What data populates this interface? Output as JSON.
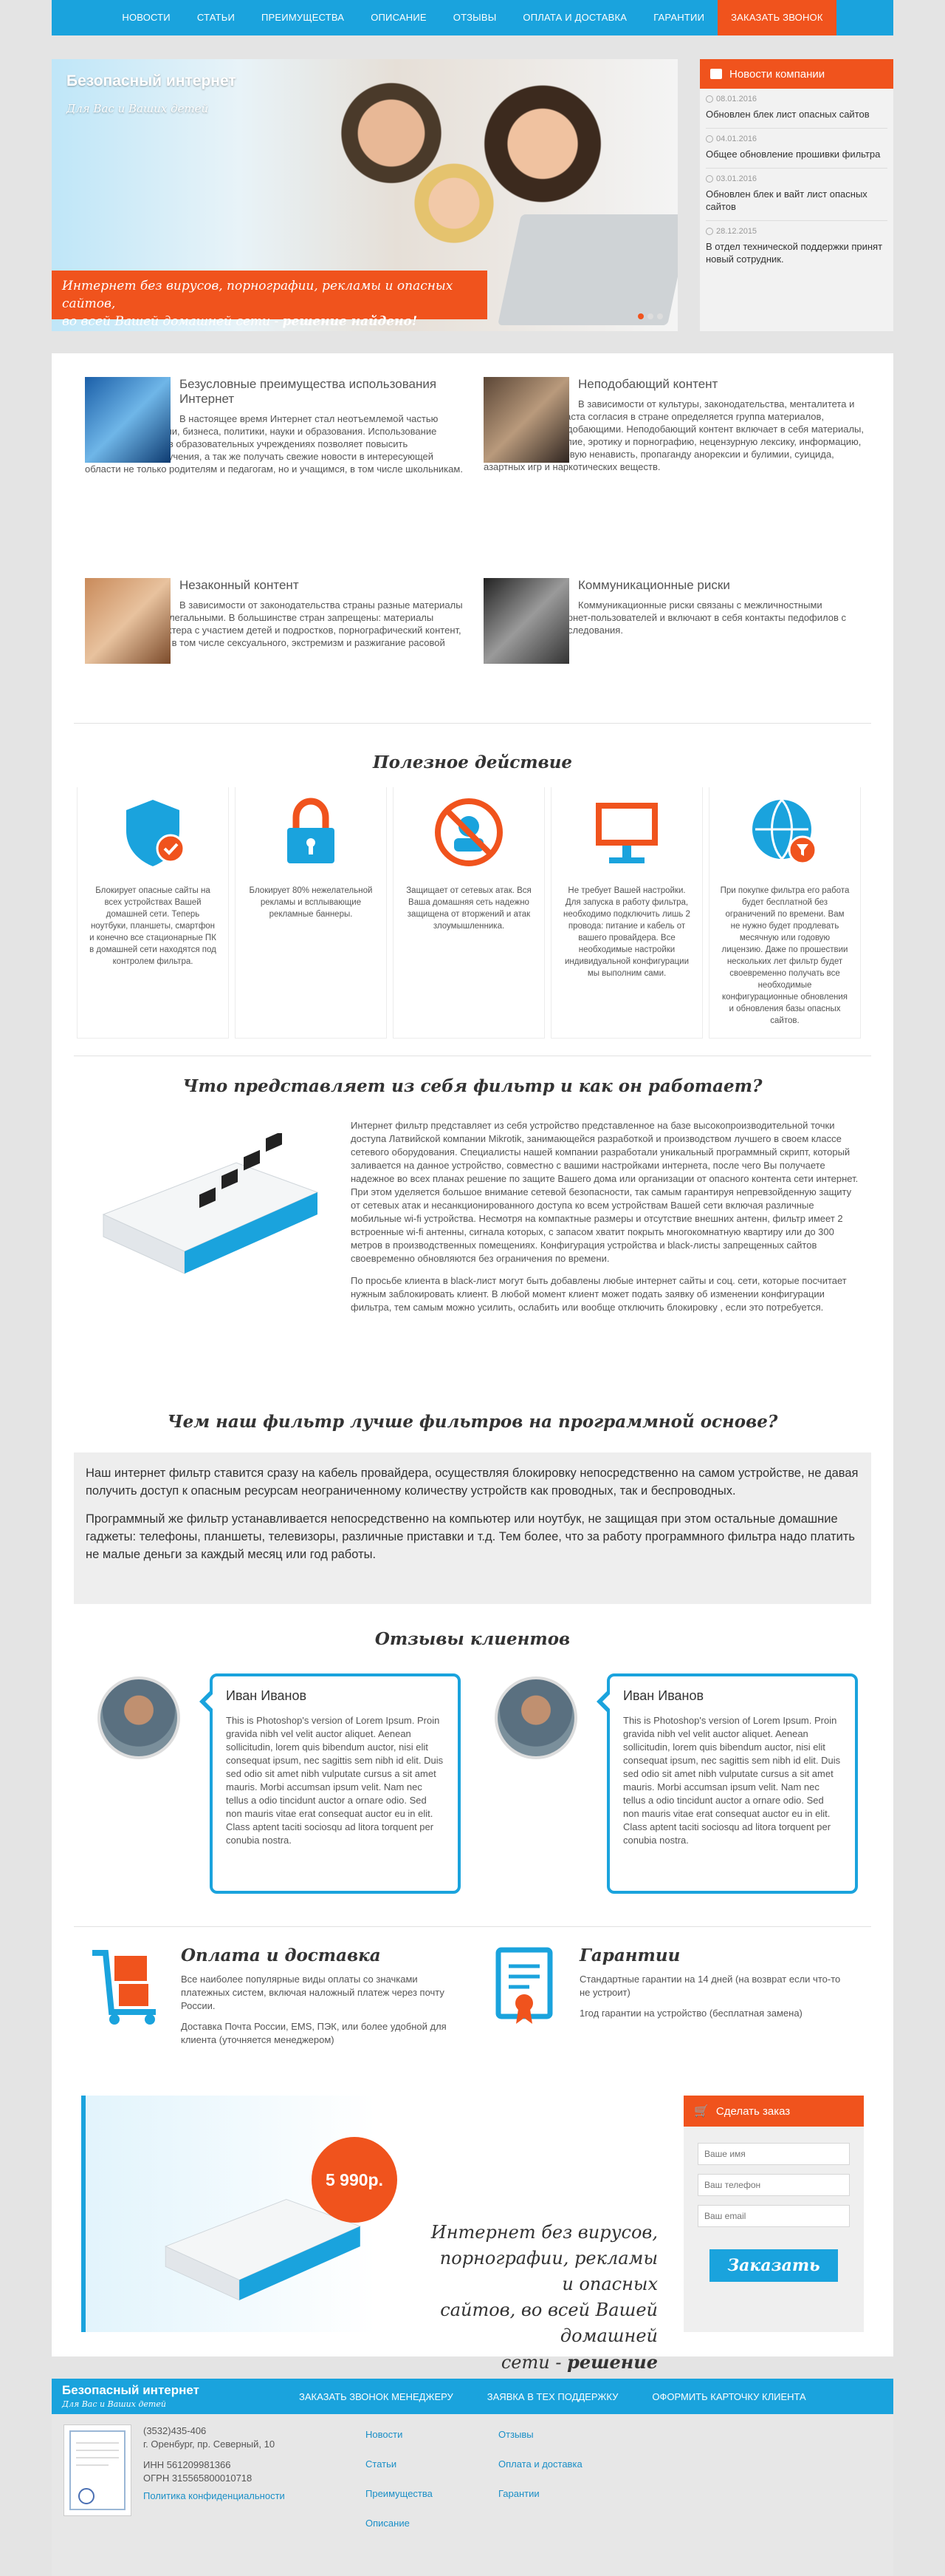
{
  "nav": {
    "items": [
      "НОВОСТИ",
      "СТАТЬИ",
      "ПРЕИМУЩЕСТВА",
      "ОПИСАНИЕ",
      "ОТЗЫВЫ",
      "ОПЛАТА И ДОСТАВКА",
      "ГАРАНТИИ"
    ],
    "callback": "ЗАКАЗАТЬ ЗВОНОК"
  },
  "hero": {
    "title": "Безопасный интернет",
    "subtitle": "Для Вас и Ваших детей",
    "banner_line1": "Интернет без вирусов, порнографии, рекламы и опасных сайтов,",
    "banner_line2": "во всей Вашей домашней сети - ",
    "banner_bold": "решение найдено!"
  },
  "news": {
    "title": "Новости компании",
    "items": [
      {
        "date": "08.01.2016",
        "text": "Обновлен блек лист опасных сайтов"
      },
      {
        "date": "04.01.2016",
        "text": "Общее обновление прошивки фильтра"
      },
      {
        "date": "03.01.2016",
        "text": "Обновлен блек и вайт лист опасных сайтов"
      },
      {
        "date": "28.12.2015",
        "text": "В отдел технической поддержки принят новый сотрудник."
      }
    ]
  },
  "advantages": [
    {
      "title": "Безусловные преимущества использования Интернет",
      "text": "В настоящее время Интернет стал неотъемлемой частью повседневной жизни, бизнеса, политики, науки и образования. Использование Интернета дома и в образовательных учреждениях позволяет повысить эффективность обучения, а так же получать свежие новости в интересующей области не только родителям и педагогам, но и учащимся, в том числе школьникам."
    },
    {
      "title": "Неподобающий контент",
      "text": "В зависимости от культуры, законодательства, менталитета и узаконенного возраста согласия в стране определяется группа материалов, считающихся неподобающими. Неподобающий контент включает в себя материалы, содержащие: насилие, эротику и порнографию, нецензурную лексику, информацию, разжигающую расовую ненависть, пропаганду анорексии и булимии, суицида, азартных игр и наркотических веществ."
    },
    {
      "title": "Незаконный контент",
      "text": "В зависимости от законодательства страны разные материалы могут считаться нелегальными. В большинстве стран запрещены: материалы сексуального характера с участием детей и подростков, порнографический контент, описания насилия, в том числе сексуального, экстремизм и разжигание расовой ненависти."
    },
    {
      "title": "Коммуникационные риски",
      "text": "Коммуникационные риски связаны с межличностными отношениями интернет-пользователей и включают в себя контакты педофилов с детьми и киберпреследования."
    }
  ],
  "useful": {
    "title": "Полезное действие",
    "items": [
      "Блокирует опасные сайты на всех устройствах Вашей домашней сети. Теперь ноутбуки, планшеты, смартфон и конечно все стационарные ПК в домашней сети находятся под контролем фильтра.",
      "Блокирует 80% нежелательной рекламы и всплывающие рекламные баннеры.",
      "Защищает от сетевых атак. Вся Ваша домашняя сеть надежно защищена от вторжений и атак злоумышленника.",
      "Не требует Вашей настройки. Для запуска в работу фильтра, необходимо подключить лишь 2 провода: питание и кабель от вашего провайдера. Все необходимые настройки индивидуальной конфигурации мы выполним сами.",
      "При покупке фильтра его работа будет бесплатной без ограничений по времени. Вам не нужно будет продлевать месячную или годовую лицензию. Даже по прошествии нескольких лет фильтр будет своевременно получать все необходимые конфигурационные обновления и обновления базы опасных сайтов."
    ]
  },
  "filter": {
    "title": "Что представляет из себя фильтр и как он работает?",
    "p1": "Интернет фильтр представляет из себя устройство представленное на базе высокопроизводительной точки доступа Латвийской компании Mikrotik, занимающейся разработкой и производством лучшего в своем классе сетевого оборудования. Специалисты нашей компании разработали уникальный программный скрипт, который заливается на данное устройство, совместно с вашими настройками интернета, после чего Вы получаете надежное во всех планах решение по защите Вашего дома или организации от опасного контента сети интернет. При этом уделяется большое внимание сетевой безопасности, так самым гарантируя непревзойденную защиту от сетевых атак и несанкционированного доступа ко всем устройствам Вашей сети включая различные мобильные wi-fi устройства. Несмотря на компактные размеры и отсутствие внешних антенн, фильтр имеет 2 встроенные wi-fi антенны, сигнала которых, с запасом хватит покрыть многокомнатную квартиру или до 300 метров в производственных помещениях. Конфигурация устройства и black-листы запрещенных сайтов своевременно обновляются без ограничения по времени.",
    "p2": "По просьбе клиента в black-лист могут быть добавлены любые интернет сайты и соц. сети, которые посчитает нужным заблокировать клиент. В любой момент клиент может подать заявку об изменении конфигурации фильтра, тем самым можно усилить, ослабить или вообще отключить блокировку , если это потребуется."
  },
  "better": {
    "title": "Чем наш фильтр лучше фильтров на программной основе?",
    "p1": "Наш интернет фильтр ставится сразу на кабель провайдера, осуществляя блокировку непосредственно на самом устройстве, не давая получить доступ к опасным ресурсам неограниченному количеству устройств как проводных, так и беспроводных.",
    "p2": "Программный же фильтр устанавливается непосредственно на компьютер или ноутбук, не защищая при этом остальные домашние гаджеты: телефоны, планшеты, телевизоры, различные приставки и т.д. Тем более, что за работу программного фильтра надо платить не малые деньги за каждый месяц или год работы."
  },
  "reviews": {
    "title": "Отзывы клиентов",
    "items": [
      {
        "name": "Иван Иванов",
        "text": "This is Photoshop's version of Lorem Ipsum. Proin gravida nibh vel velit auctor aliquet. Aenean sollicitudin, lorem quis bibendum auctor, nisi elit consequat ipsum, nec sagittis sem nibh id elit. Duis sed odio sit amet nibh vulputate cursus a sit amet mauris. Morbi accumsan ipsum velit. Nam nec tellus a odio tincidunt auctor a ornare odio. Sed non mauris vitae erat consequat auctor eu in elit. Class aptent taciti sociosqu ad litora torquent per conubia nostra."
      },
      {
        "name": "Иван Иванов",
        "text": "This is Photoshop's version of Lorem Ipsum. Proin gravida nibh vel velit auctor aliquet. Aenean sollicitudin, lorem quis bibendum auctor, nisi elit consequat ipsum, nec sagittis sem nibh id elit. Duis sed odio sit amet nibh vulputate cursus a sit amet mauris. Morbi accumsan ipsum velit. Nam nec tellus a odio tincidunt auctor a ornare odio. Sed non mauris vitae erat consequat auctor eu in elit. Class aptent taciti sociosqu ad litora torquent per conubia nostra."
      }
    ]
  },
  "delivery": {
    "title": "Оплата и доставка",
    "p1": "Все наиболее популярные виды оплаты со значками платежных систем, включая наложный платеж через почту России.",
    "p2": "Доставка Почта России, EMS, ПЭК, или более удобной для клиента (уточняется менеджером)"
  },
  "warranty": {
    "title": "Гарантии",
    "p1": "Стандартные гарантии на 14 дней (на возврат если что-то не устроит)",
    "p2": "1год гарантии на устройство (бесплатная замена)"
  },
  "promo": {
    "price": "5 990р.",
    "line1": "Интернет без вирусов,",
    "line2": "порнографии, рекламы и опасных",
    "line3": "сайтов, во всей Вашей домашней",
    "line4_pre": "сети - ",
    "line4_bold": "решение найдено!"
  },
  "order": {
    "title": "Сделать заказ",
    "name_ph": "Ваше имя",
    "phone_ph": "Ваш телефон",
    "email_ph": "Ваш email",
    "submit": "Заказать"
  },
  "footer": {
    "title": "Безопасный интернет",
    "subtitle": "Для Вас и Ваших детей",
    "links": [
      "ЗАКАЗАТЬ ЗВОНОК МЕНЕДЖЕРУ",
      "ЗАЯВКА В ТЕХ ПОДДЕРЖКУ",
      "ОФОРМИТЬ КАРТОЧКУ КЛИЕНТА"
    ],
    "phone": "(3532)435-406",
    "address": "г. Оренбург, пр. Северный, 10",
    "inn": "ИНН 561209981366",
    "ogrn": "ОГРН 315565800010718",
    "privacy": "Политика конфиденциальности",
    "col1": [
      "Новости",
      "Статьи",
      "Преимущества",
      "Описание"
    ],
    "col2": [
      "Отзывы",
      "Оплата и доставка",
      "Гарантии"
    ]
  },
  "colors": {
    "accent_blue": "#1aa3dd",
    "accent_orange": "#f0531d"
  }
}
